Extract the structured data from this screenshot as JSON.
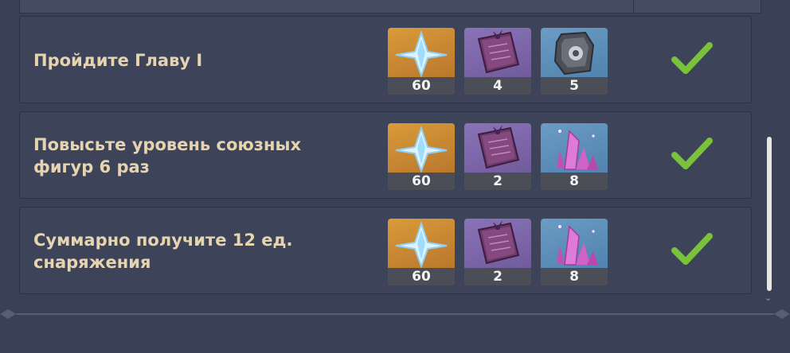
{
  "quests": [
    {
      "title": "Пройдите Главу I",
      "rewards": [
        {
          "icon": "primogem-icon",
          "bg": "gold",
          "count": "60"
        },
        {
          "icon": "wanderers-advice-book-icon",
          "bg": "purple",
          "count": "4"
        },
        {
          "icon": "mystic-ore-icon",
          "bg": "blue",
          "count": "5"
        }
      ],
      "completed": true
    },
    {
      "title": "Повысьте уровень союзных\nфигур 6 раз",
      "rewards": [
        {
          "icon": "primogem-icon",
          "bg": "gold",
          "count": "60"
        },
        {
          "icon": "wanderers-advice-book-icon",
          "bg": "purple",
          "count": "2"
        },
        {
          "icon": "crystal-ore-icon",
          "bg": "blue",
          "count": "8"
        }
      ],
      "completed": true
    },
    {
      "title": "Суммарно получите 12 ед.\nснаряжения",
      "rewards": [
        {
          "icon": "primogem-icon",
          "bg": "gold",
          "count": "60"
        },
        {
          "icon": "wanderers-advice-book-icon",
          "bg": "purple",
          "count": "2"
        },
        {
          "icon": "crystal-ore-icon",
          "bg": "blue",
          "count": "8"
        }
      ],
      "completed": true
    }
  ],
  "colors": {
    "title": "#e6d4b0",
    "check": "#7ac23a",
    "background": "#3a4156"
  }
}
